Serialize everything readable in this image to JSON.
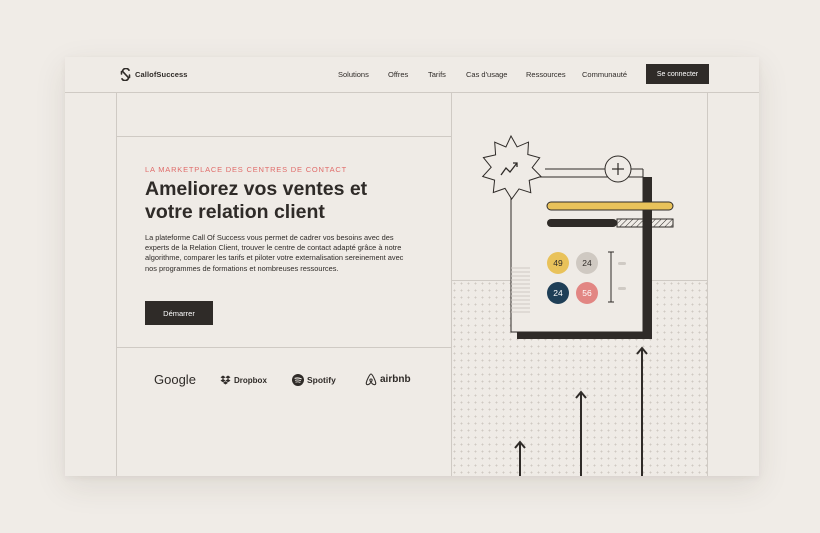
{
  "brand": {
    "name": "CallofSuccess"
  },
  "nav": {
    "items": [
      "Solutions",
      "Offres",
      "Tarifs",
      "Cas d'usage",
      "Ressources",
      "Communauté"
    ],
    "cta_label": "Se connecter"
  },
  "hero": {
    "eyebrow": "LA MARKETPLACE DES CENTRES DE CONTACT",
    "headline_line1": "Ameliorez vos ventes et",
    "headline_line2": "votre relation client",
    "description": "La plateforme Call Of Success vous permet de cadrer vos besoins avec des experts de la Relation Client, trouver le centre de contact adapté grâce à notre algorithme, comparer les tarifs et piloter votre externalisation sereinement avec nos programmes de formations et nombreuses ressources.",
    "button_label": "Démarrer"
  },
  "partners": [
    "Google",
    "Dropbox",
    "Spotify",
    "airbnb"
  ],
  "illustration": {
    "bubbles": [
      {
        "value": "49",
        "color": "#e9c25a",
        "text_color": "#2f2b28"
      },
      {
        "value": "24",
        "color": "#cfc9c2",
        "text_color": "#2f2b28"
      },
      {
        "value": "24",
        "color": "#1f3f57",
        "text_color": "#ffffff"
      },
      {
        "value": "56",
        "color": "#e28683",
        "text_color": "#ffffff"
      }
    ],
    "colors": {
      "ink": "#2f2b28",
      "yellow": "#e9c25a",
      "grid": "#cfcac4"
    }
  }
}
